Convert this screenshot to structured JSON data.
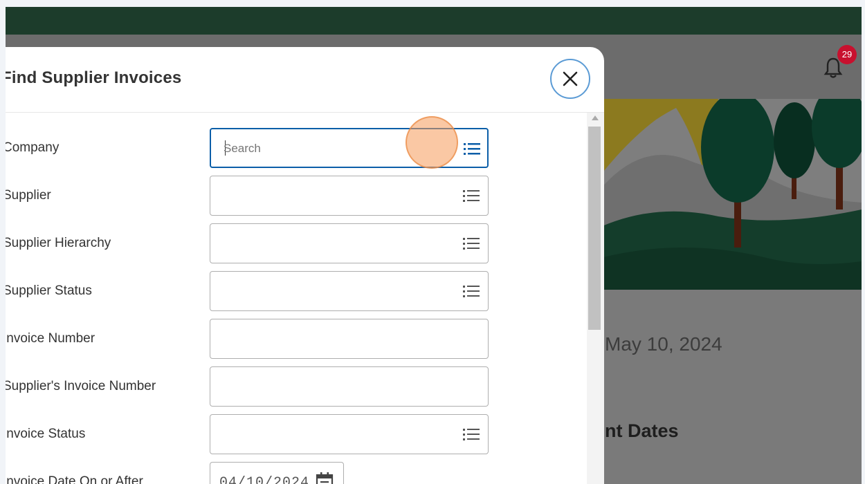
{
  "notifications": {
    "count": "29",
    "icon": "bell-icon"
  },
  "background": {
    "date": "May 10, 2024",
    "section_heading": "nt Dates"
  },
  "modal": {
    "title": "Find Supplier Invoices",
    "close_icon": "close-icon",
    "fields": [
      {
        "label": "Company",
        "type": "prompt",
        "placeholder": "Search",
        "value": "",
        "active": true
      },
      {
        "label": "Supplier",
        "type": "prompt",
        "value": ""
      },
      {
        "label": "Supplier Hierarchy",
        "type": "prompt",
        "value": ""
      },
      {
        "label": "Supplier Status",
        "type": "prompt",
        "value": ""
      },
      {
        "label": "Invoice Number",
        "type": "text",
        "value": ""
      },
      {
        "label": "Supplier's Invoice Number",
        "type": "text",
        "value": ""
      },
      {
        "label": "Invoice Status",
        "type": "prompt",
        "value": ""
      },
      {
        "label": "Invoice Date On or After",
        "type": "date",
        "value": "04/10/2024"
      }
    ]
  },
  "colors": {
    "header": "#1c3c2b",
    "focus_border": "#0b5ea8",
    "close_border": "#5b9bd5",
    "badge": "#c8102e"
  }
}
